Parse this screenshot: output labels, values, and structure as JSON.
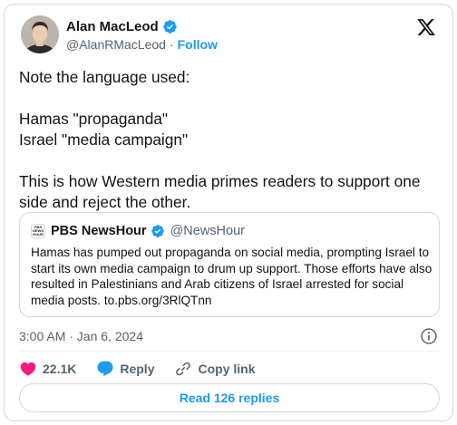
{
  "author": {
    "name": "Alan MacLeod",
    "handle": "@AlanRMacLeod",
    "separator": "·",
    "follow_label": "Follow"
  },
  "tweet": {
    "text": "Note the language used:\n\nHamas \"propaganda\"\nIsrael \"media campaign\"\n\nThis is how Western media primes readers to support one side and reject the other."
  },
  "quoted": {
    "logo_lines": [
      "PBS",
      "NEWS",
      "HOUR"
    ],
    "name": "PBS NewsHour",
    "handle": "@NewsHour",
    "text": "Hamas has pumped out propaganda on social media, prompting Israel to start its own media campaign to drum up support. Those efforts have also resulted in Palestinians and Arab citizens of Israel arrested for social media posts. to.pbs.org/3RlQTnn"
  },
  "meta": {
    "timestamp": "3:00 AM · Jan 6, 2024"
  },
  "actions": {
    "like_count": "22.1K",
    "reply_label": "Reply",
    "copy_link_label": "Copy link"
  },
  "read_replies_label": "Read 126 replies",
  "colors": {
    "accent": "#1d9bf0",
    "like": "#f91880",
    "text": "#0f1419",
    "muted": "#536471",
    "border": "#cfd9de"
  },
  "icons": [
    "verified-badge-icon",
    "x-logo-icon",
    "info-icon",
    "heart-icon",
    "reply-bubble-icon",
    "link-icon"
  ]
}
